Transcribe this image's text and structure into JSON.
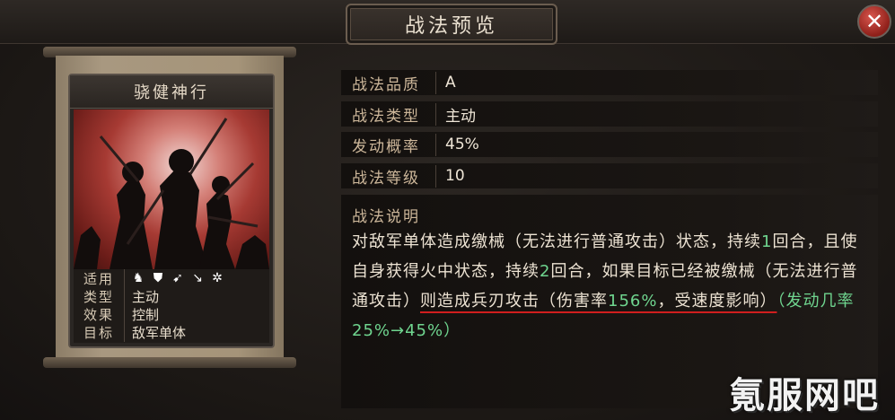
{
  "window": {
    "title": "战法预览"
  },
  "card": {
    "name": "骁健神行",
    "info": [
      {
        "key": "适用",
        "value": ""
      },
      {
        "key": "类型",
        "value": "主动"
      },
      {
        "key": "效果",
        "value": "控制"
      },
      {
        "key": "目标",
        "value": "敌军单体"
      }
    ],
    "unit_icons": [
      "cavalry-icon",
      "shield-icon",
      "bow-icon",
      "spear-icon",
      "chariot-icon"
    ]
  },
  "attributes": [
    {
      "key": "战法品质",
      "value": "A"
    },
    {
      "key": "战法类型",
      "value": "主动"
    },
    {
      "key": "发动概率",
      "value": "45%"
    },
    {
      "key": "战法等级",
      "value": "10"
    }
  ],
  "description": {
    "title": "战法说明",
    "part1": "对敌军单体造成缴械（无法进行普通攻击）状态，持续",
    "part1_num": "1",
    "part2": "回合，且使自身获得火中状态，持续",
    "part2_num": "2",
    "part3": "回合，如果目标已经被缴械（无法进行普通攻击）",
    "part4": "则造成兵刃攻击（伤害率",
    "rate": "156%",
    "part5": "，受速度影响）",
    "bonus": "（发动几率25%→45%）"
  },
  "watermark": "氪服网吧",
  "colors": {
    "label": "#cdb79a",
    "green": "#6fd58f",
    "close_red": "#b5302a"
  }
}
